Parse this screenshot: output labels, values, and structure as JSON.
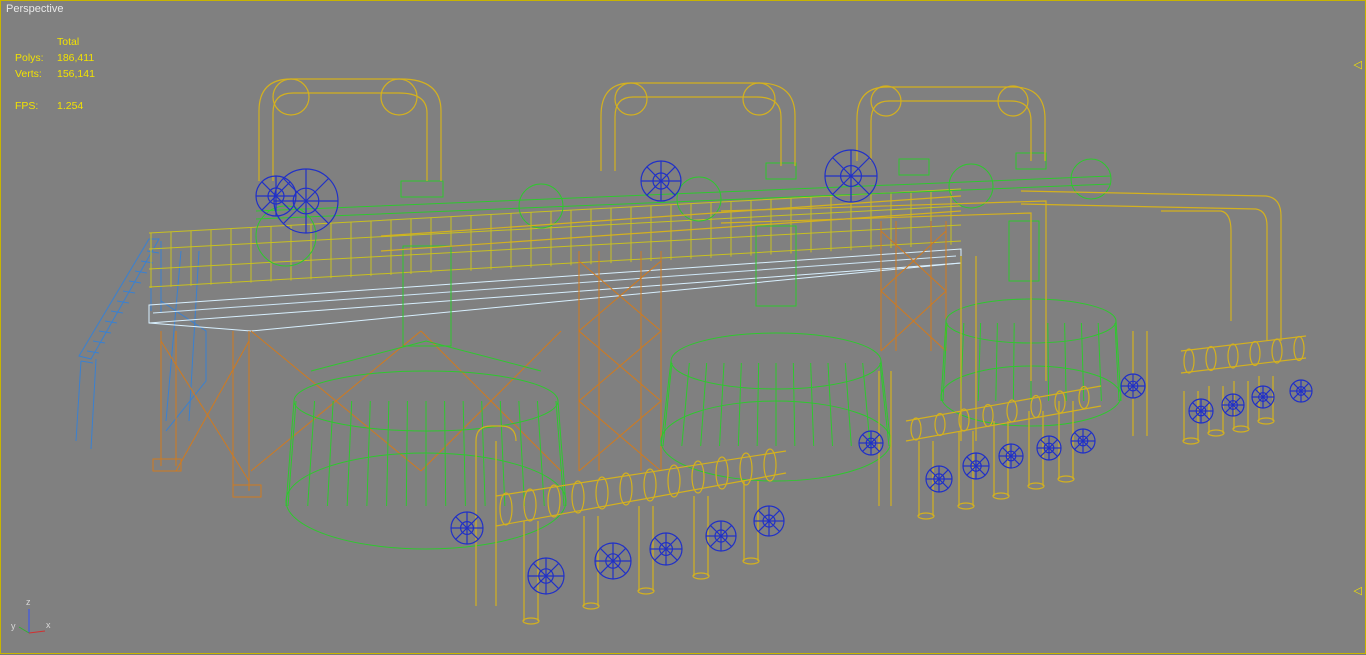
{
  "viewport": {
    "label": "Perspective",
    "border_color": "#c8b400",
    "background": "#808080"
  },
  "stats": {
    "header": "Total",
    "polys_label": "Polys:",
    "polys_value": "186,411",
    "verts_label": "Verts:",
    "verts_value": "156,141",
    "fps_label": "FPS:",
    "fps_value": "1.254"
  },
  "axis_gizmo": {
    "z": "z",
    "x": "x",
    "y": "y"
  },
  "edge_markers": {
    "top": "◁",
    "bottom": "◁"
  },
  "wire_colors": {
    "pipes": "#d4b11e",
    "valves": "#2030c8",
    "tanks": "#2ec82e",
    "frames": "#d07a1e",
    "stairs": "#3a80d0",
    "deck": "#d8f0ff",
    "railing": "#c8c020"
  }
}
